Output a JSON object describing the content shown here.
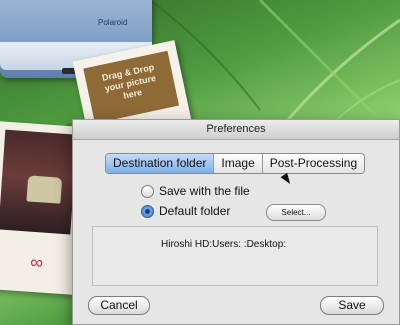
{
  "background": {
    "accent": "#4f9a3f"
  },
  "camera": {
    "brand": "Polaroid"
  },
  "photo": {
    "lines": [
      "Drag & Drop",
      "your picture",
      "here"
    ]
  },
  "dialog": {
    "title": "Preferences",
    "tabs": [
      {
        "label": "Destination folder",
        "active": true
      },
      {
        "label": "Image",
        "active": false
      },
      {
        "label": "Post-Processing",
        "active": false
      }
    ],
    "options": {
      "save_with_file": "Save with the file",
      "default_folder": "Default folder",
      "selected": "default_folder"
    },
    "select_button": "Select...",
    "path": "Hiroshi HD:Users:          :Desktop:",
    "cancel": "Cancel",
    "save": "Save"
  },
  "icons": {
    "cursor": "mouse-cursor-icon"
  }
}
